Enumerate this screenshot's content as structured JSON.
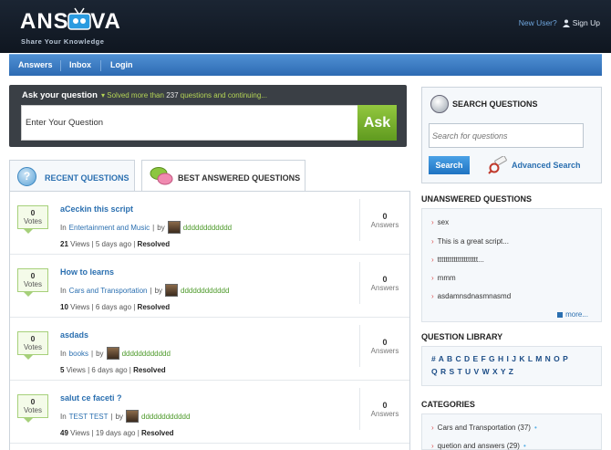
{
  "header": {
    "logo_text": "ANSWVA",
    "logo_tagline": "Share Your Knowledge",
    "new_user": "New User?",
    "sign_up": "Sign Up"
  },
  "nav": {
    "items": [
      "Answers",
      "Inbox",
      "Login"
    ]
  },
  "ask": {
    "title": "Ask your question",
    "sub_prefix": "Solved more than",
    "sub_count": "237",
    "sub_suffix": "questions and continuing...",
    "placeholder": "Enter Your Question",
    "button": "Ask"
  },
  "tabs": {
    "recent": "RECENT QUESTIONS",
    "best": "BEST ANSWERED QUESTIONS"
  },
  "questions": [
    {
      "votes": "0",
      "votes_label": "Votes",
      "title": "aCeckin this script",
      "in": "In",
      "category": "Entertainment and Music",
      "by": "by",
      "user": "dddddddddddd",
      "views": "21",
      "views_label": "Views",
      "age": "5 days ago",
      "status": "Resolved",
      "answers": "0",
      "answers_label": "Answers"
    },
    {
      "votes": "0",
      "votes_label": "Votes",
      "title": "How to learns",
      "in": "In",
      "category": "Cars and Transportation",
      "by": "by",
      "user": "dddddddddddd",
      "views": "10",
      "views_label": "Views",
      "age": "6 days ago",
      "status": "Resolved",
      "answers": "0",
      "answers_label": "Answers"
    },
    {
      "votes": "0",
      "votes_label": "Votes",
      "title": "asdads",
      "in": "In",
      "category": "books",
      "by": "by",
      "user": "dddddddddddd",
      "views": "5",
      "views_label": "Views",
      "age": "6 days ago",
      "status": "Resolved",
      "answers": "0",
      "answers_label": "Answers"
    },
    {
      "votes": "0",
      "votes_label": "Votes",
      "title": "salut ce faceti ?",
      "in": "In",
      "category": "TEST TEST",
      "by": "by",
      "user": "dddddddddddd",
      "views": "49",
      "views_label": "Views",
      "age": "19 days ago",
      "status": "Resolved",
      "answers": "0",
      "answers_label": "Answers"
    }
  ],
  "search": {
    "title": "SEARCH QUESTIONS",
    "placeholder": "Search for questions",
    "button": "Search",
    "advanced": "Advanced Search"
  },
  "unanswered": {
    "title": "UNANSWERED QUESTIONS",
    "items": [
      "sex",
      "This is a great script...",
      "tttttttttttttttttttt...",
      "mmm",
      "asdamnsdnasmnasmd"
    ],
    "more": "more..."
  },
  "library": {
    "title": "QUESTION LIBRARY",
    "row1": "# A B C D E F G H I J K L M N O P",
    "row2": "Q R S T U V W X Y Z"
  },
  "categories": {
    "title": "CATEGORIES",
    "items": [
      "Cars and Transportation (37)",
      "quetion and answers (29)"
    ]
  }
}
